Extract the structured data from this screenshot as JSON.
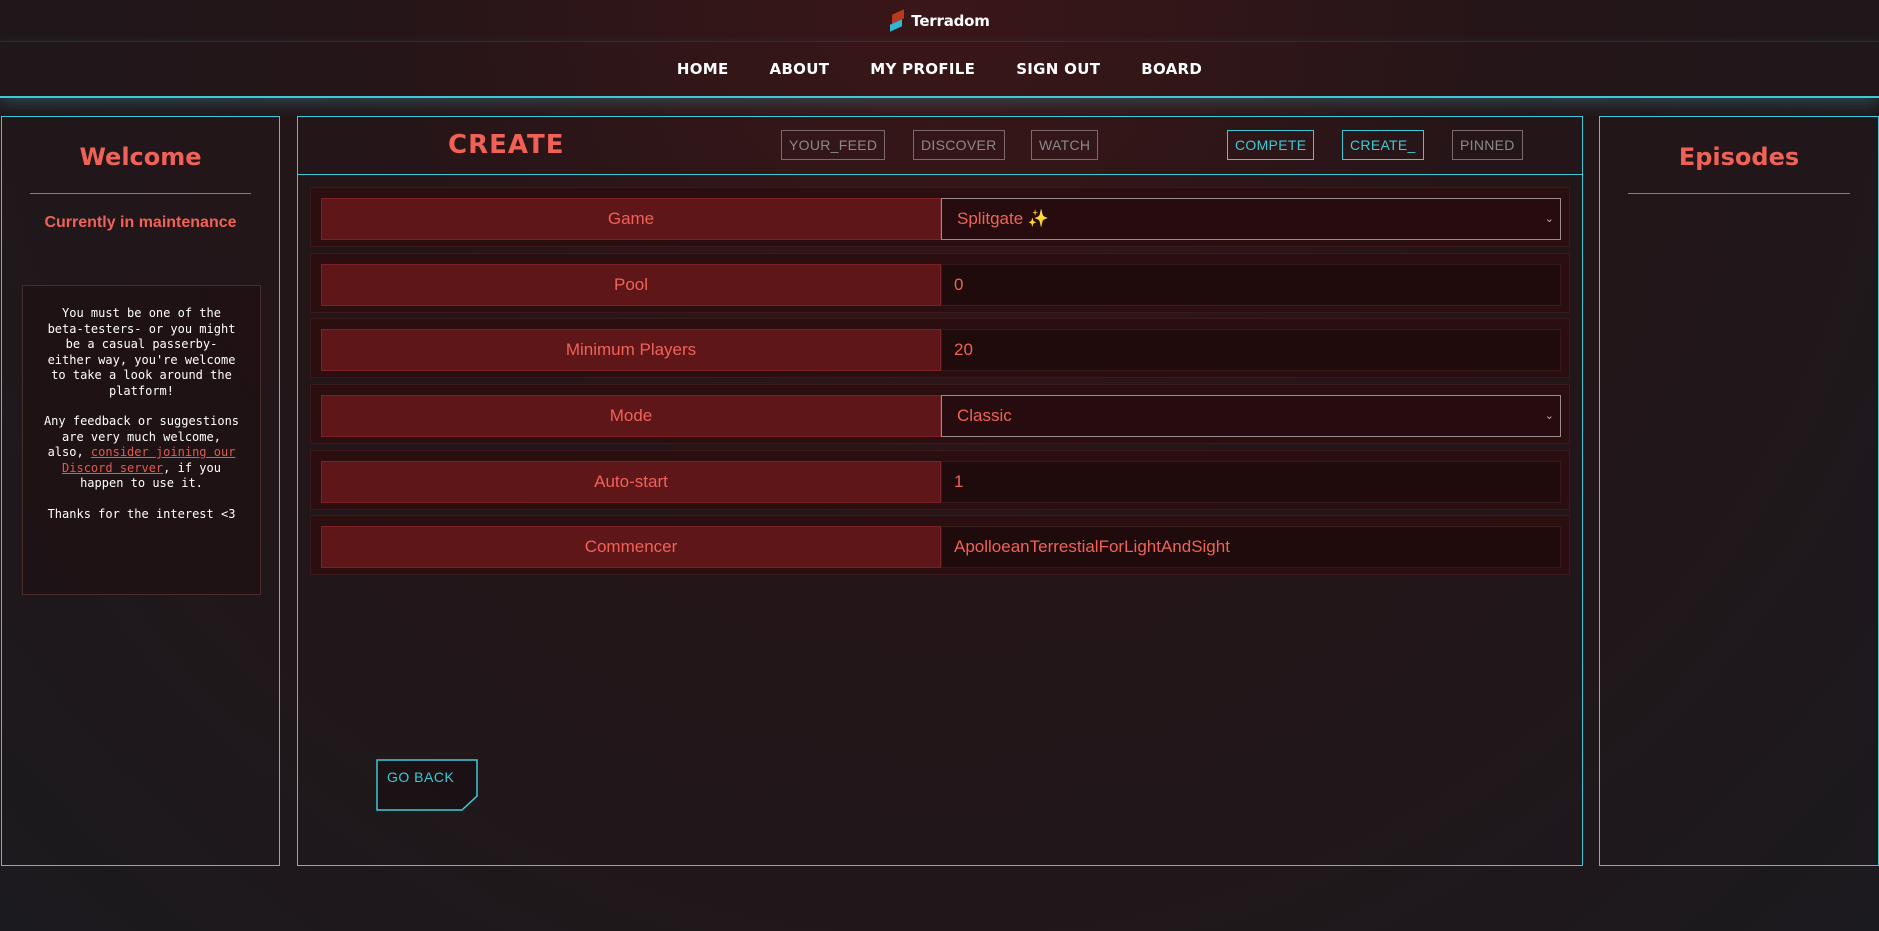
{
  "brand": {
    "name": "Terradom",
    "logo_icon": "terradom-logo-icon"
  },
  "nav": {
    "items": [
      "HOME",
      "ABOUT",
      "MY PROFILE",
      "SIGN OUT",
      "BOARD"
    ]
  },
  "left_sidebar": {
    "title": "Welcome",
    "status": "Currently in maintenance",
    "notice": {
      "p1": "You must be one of the beta-testers- or you might be a casual passerby- either way, you're welcome to take a look around the platform!",
      "p2_before": "Any feedback or suggestions are very much welcome, also, ",
      "p2_link": "consider joining our Discord server",
      "p2_after": ", if you happen to use it.",
      "p3": "Thanks for the interest <3"
    }
  },
  "main": {
    "title": "CREATE",
    "tabs": [
      "YOUR_FEED",
      "DISCOVER",
      "WATCH",
      "COMPETE",
      "CREATE_",
      "PINNED"
    ],
    "form": {
      "game": {
        "label": "Game",
        "value": "Splitgate ✨"
      },
      "pool": {
        "label": "Pool",
        "value": "0"
      },
      "min_players": {
        "label": "Minimum Players",
        "value": "20"
      },
      "mode": {
        "label": "Mode",
        "value": "Classic"
      },
      "auto_start": {
        "label": "Auto-start",
        "value": "1"
      },
      "commencer": {
        "label": "Commencer",
        "value": "ApolloeanTerrestialForLightAndSight"
      }
    },
    "go_back_label": "GO BACK"
  },
  "right_sidebar": {
    "title": "Episodes"
  },
  "colors": {
    "accent_cyan": "#3fc9d6",
    "accent_red": "#f06258",
    "label_bg": "#5e1619"
  }
}
